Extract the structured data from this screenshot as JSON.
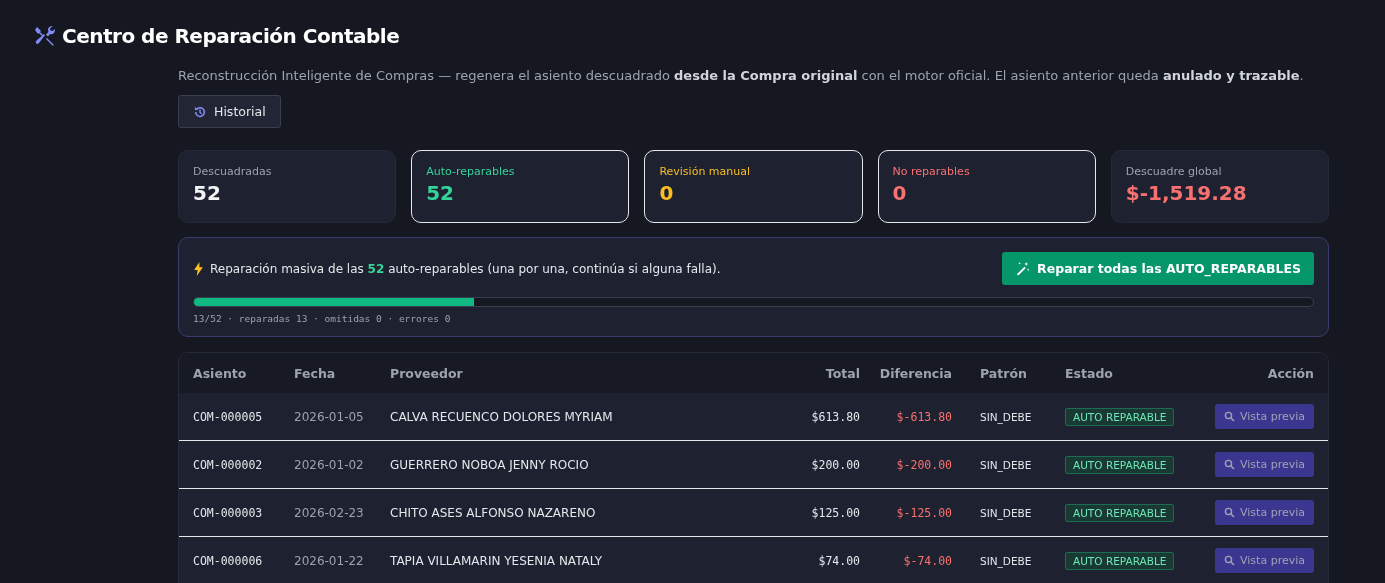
{
  "title": "Centro de Reparación Contable",
  "description": "Reconstrucción Inteligente de Compras — regenera el asiento descuadrado **desde la Compra original** con el motor oficial. El asiento anterior queda **anulado y trazable**.",
  "history_button": "Historial",
  "stats": [
    {
      "label": "Descuadradas",
      "value": "52",
      "color": "#f3f4f6",
      "outlined": false
    },
    {
      "label": "Auto-reparables",
      "value": "52",
      "color": "#34d399",
      "outlined": true
    },
    {
      "label": "Revisión manual",
      "value": "0",
      "color": "#fbbf24",
      "outlined": true
    },
    {
      "label": "No reparables",
      "value": "0",
      "color": "#f87171",
      "outlined": true
    },
    {
      "label": "Descuadre global",
      "value": "$-1,519.28",
      "color": "#f87171",
      "outlined": false
    }
  ],
  "bulk": {
    "message": "Reparación masiva de las **52** auto-reparables (una por una, continúa si alguna falla).",
    "button": "Reparar todas las AUTO_REPARABLES",
    "level": 0.25,
    "progress_text": "13/52 · reparadas 13 · omitidas 0 · errores 0"
  },
  "table": {
    "columns": [
      "Asiento",
      "Fecha",
      "Proveedor",
      "Total",
      "Diferencia",
      "Patrón",
      "Estado",
      "Acción"
    ],
    "rows": [
      {
        "asiento": "COM-000005",
        "fecha": "2026-01-05",
        "proveedor": "CALVA RECUENCO DOLORES MYRIAM",
        "total": "$613.80",
        "diferencia": "$-613.80",
        "patron": "SIN_DEBE",
        "estado": "AUTO REPARABLE",
        "accion": "Vista previa",
        "disabled": true
      },
      {
        "asiento": "COM-000002",
        "fecha": "2026-01-02",
        "proveedor": "GUERRERO NOBOA JENNY ROCIO",
        "total": "$200.00",
        "diferencia": "$-200.00",
        "patron": "SIN_DEBE",
        "estado": "AUTO REPARABLE",
        "accion": "Vista previa",
        "disabled": true
      },
      {
        "asiento": "COM-000003",
        "fecha": "2026-02-23",
        "proveedor": "CHITO ASES ALFONSO NAZARENO",
        "total": "$125.00",
        "diferencia": "$-125.00",
        "patron": "SIN_DEBE",
        "estado": "AUTO REPARABLE",
        "accion": "Vista previa",
        "disabled": true
      },
      {
        "asiento": "COM-000006",
        "fecha": "2026-01-22",
        "proveedor": "TAPIA VILLAMARIN YESENIA NATALY",
        "total": "$74.00",
        "diferencia": "$-74.00",
        "patron": "SIN_DEBE",
        "estado": "AUTO REPARABLE",
        "accion": "Vista previa",
        "disabled": true
      }
    ]
  }
}
